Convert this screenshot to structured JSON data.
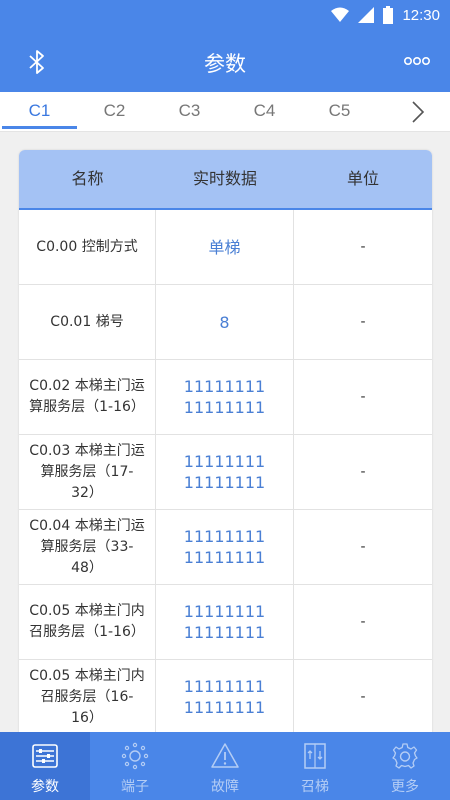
{
  "status": {
    "time": "12:30"
  },
  "appbar": {
    "title": "参数",
    "bluetooth_icon": "bluetooth-icon",
    "more_icon": "more-icon"
  },
  "tabs": [
    {
      "label": "C1",
      "active": true
    },
    {
      "label": "C2",
      "active": false
    },
    {
      "label": "C3",
      "active": false
    },
    {
      "label": "C4",
      "active": false
    },
    {
      "label": "C5",
      "active": false
    }
  ],
  "table": {
    "headers": {
      "name": "名称",
      "value": "实时数据",
      "unit": "单位"
    },
    "rows": [
      {
        "name": "C0.00 控制方式",
        "value": "单梯",
        "unit": "-"
      },
      {
        "name": "C0.01 梯号",
        "value": "8",
        "unit": "-"
      },
      {
        "name": "C0.02 本梯主门运算服务层（1-16）",
        "value": "11111111 11111111",
        "unit": "-"
      },
      {
        "name": "C0.03 本梯主门运算服务层（17-32）",
        "value": "11111111 11111111",
        "unit": "-"
      },
      {
        "name": "C0.04 本梯主门运算服务层（33-48）",
        "value": "11111111 11111111",
        "unit": "-"
      },
      {
        "name": "C0.05 本梯主门内召服务层（1-16）",
        "value": "11111111 11111111",
        "unit": "-"
      },
      {
        "name": "C0.05 本梯主门内召服务层（16-16）",
        "value": "11111111 11111111",
        "unit": "-"
      }
    ]
  },
  "bottom_nav": [
    {
      "label": "参数",
      "icon": "sliders-icon",
      "active": true
    },
    {
      "label": "端子",
      "icon": "terminal-icon",
      "active": false
    },
    {
      "label": "故障",
      "icon": "warning-icon",
      "active": false
    },
    {
      "label": "召梯",
      "icon": "elevator-icon",
      "active": false
    },
    {
      "label": "更多",
      "icon": "gear-icon",
      "active": false
    }
  ],
  "colors": {
    "primary": "#4a86e8",
    "header_bg": "#a4c2f4",
    "value_text": "#4a7fd4"
  }
}
